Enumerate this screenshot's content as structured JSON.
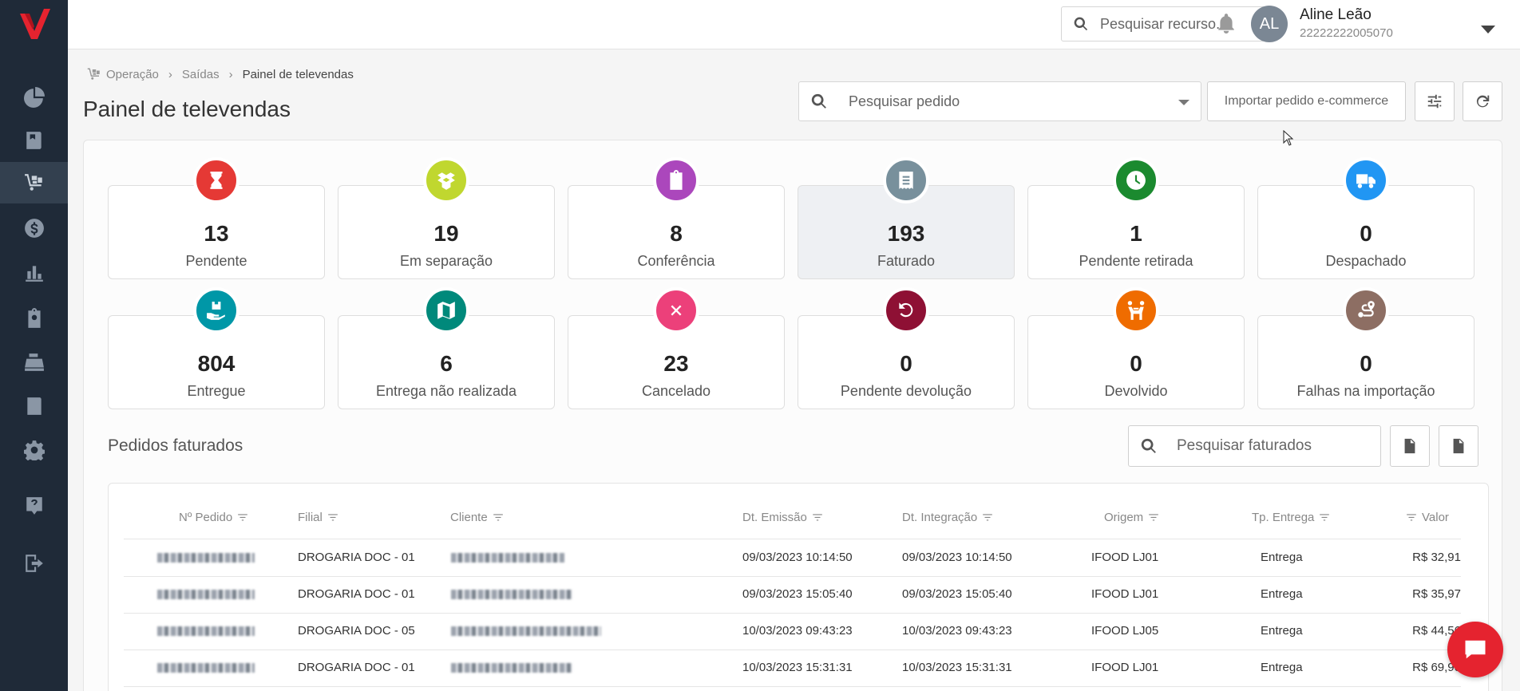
{
  "colors": {
    "sidebar": "#1f2a38",
    "brand": "#e5232f"
  },
  "user": {
    "initials": "AL",
    "name": "Aline Leão",
    "id": "22222222005070"
  },
  "top_search": {
    "placeholder": "Pesquisar recurso..."
  },
  "breadcrumb": {
    "items": [
      "Operação",
      "Saídas"
    ],
    "current": "Painel de televendas"
  },
  "page": {
    "title": "Painel de televendas",
    "order_search_placeholder": "Pesquisar pedido",
    "import_button": "Importar pedido e-commerce"
  },
  "statuses": [
    {
      "count": "13",
      "label": "Pendente",
      "color": "#e53935",
      "icon": "hourglass-icon"
    },
    {
      "count": "19",
      "label": "Em separação",
      "color": "#c0d72f",
      "icon": "box-open-icon"
    },
    {
      "count": "8",
      "label": "Conferência",
      "color": "#ab47bc",
      "icon": "clipboard-icon"
    },
    {
      "count": "193",
      "label": "Faturado",
      "color": "#78909c",
      "icon": "receipt-icon",
      "selected": true
    },
    {
      "count": "1",
      "label": "Pendente retirada",
      "color": "#1b8a2f",
      "icon": "clock-icon"
    },
    {
      "count": "0",
      "label": "Despachado",
      "color": "#2196f3",
      "icon": "truck-icon"
    },
    {
      "count": "804",
      "label": "Entregue",
      "color": "#0097a7",
      "icon": "hand-box-icon"
    },
    {
      "count": "6",
      "label": "Entrega não realizada",
      "color": "#00897b",
      "icon": "map-icon"
    },
    {
      "count": "23",
      "label": "Cancelado",
      "color": "#ec407a",
      "icon": "cancel-icon"
    },
    {
      "count": "0",
      "label": "Pendente devolução",
      "color": "#8e1034",
      "icon": "undo-icon"
    },
    {
      "count": "0",
      "label": "Devolvido",
      "color": "#ef6c00",
      "icon": "people-carry-icon"
    },
    {
      "count": "0",
      "label": "Falhas na importação",
      "color": "#8d6e63",
      "icon": "route-icon"
    }
  ],
  "section": {
    "title": "Pedidos faturados",
    "search_placeholder": "Pesquisar faturados"
  },
  "table": {
    "headers": {
      "pedido": "Nº Pedido",
      "filial": "Filial",
      "cliente": "Cliente",
      "emissao": "Dt. Emissão",
      "integracao": "Dt. Integração",
      "origem": "Origem",
      "entrega": "Tp. Entrega",
      "valor": "Valor"
    },
    "rows": [
      {
        "filial": "DROGARIA DOC - 01",
        "emissao": "09/03/2023 10:14:50",
        "integracao": "09/03/2023 10:14:50",
        "origem": "IFOOD LJ01",
        "entrega": "Entrega",
        "valor": "R$ 32,91"
      },
      {
        "filial": "DROGARIA DOC - 01",
        "emissao": "09/03/2023 15:05:40",
        "integracao": "09/03/2023 15:05:40",
        "origem": "IFOOD LJ01",
        "entrega": "Entrega",
        "valor": "R$ 35,97"
      },
      {
        "filial": "DROGARIA DOC - 05",
        "emissao": "10/03/2023 09:43:23",
        "integracao": "10/03/2023 09:43:23",
        "origem": "IFOOD LJ05",
        "entrega": "Entrega",
        "valor": "R$ 44,56"
      },
      {
        "filial": "DROGARIA DOC - 01",
        "emissao": "10/03/2023 15:31:31",
        "integracao": "10/03/2023 15:31:31",
        "origem": "IFOOD LJ01",
        "entrega": "Entrega",
        "valor": "R$ 69,90"
      }
    ]
  }
}
